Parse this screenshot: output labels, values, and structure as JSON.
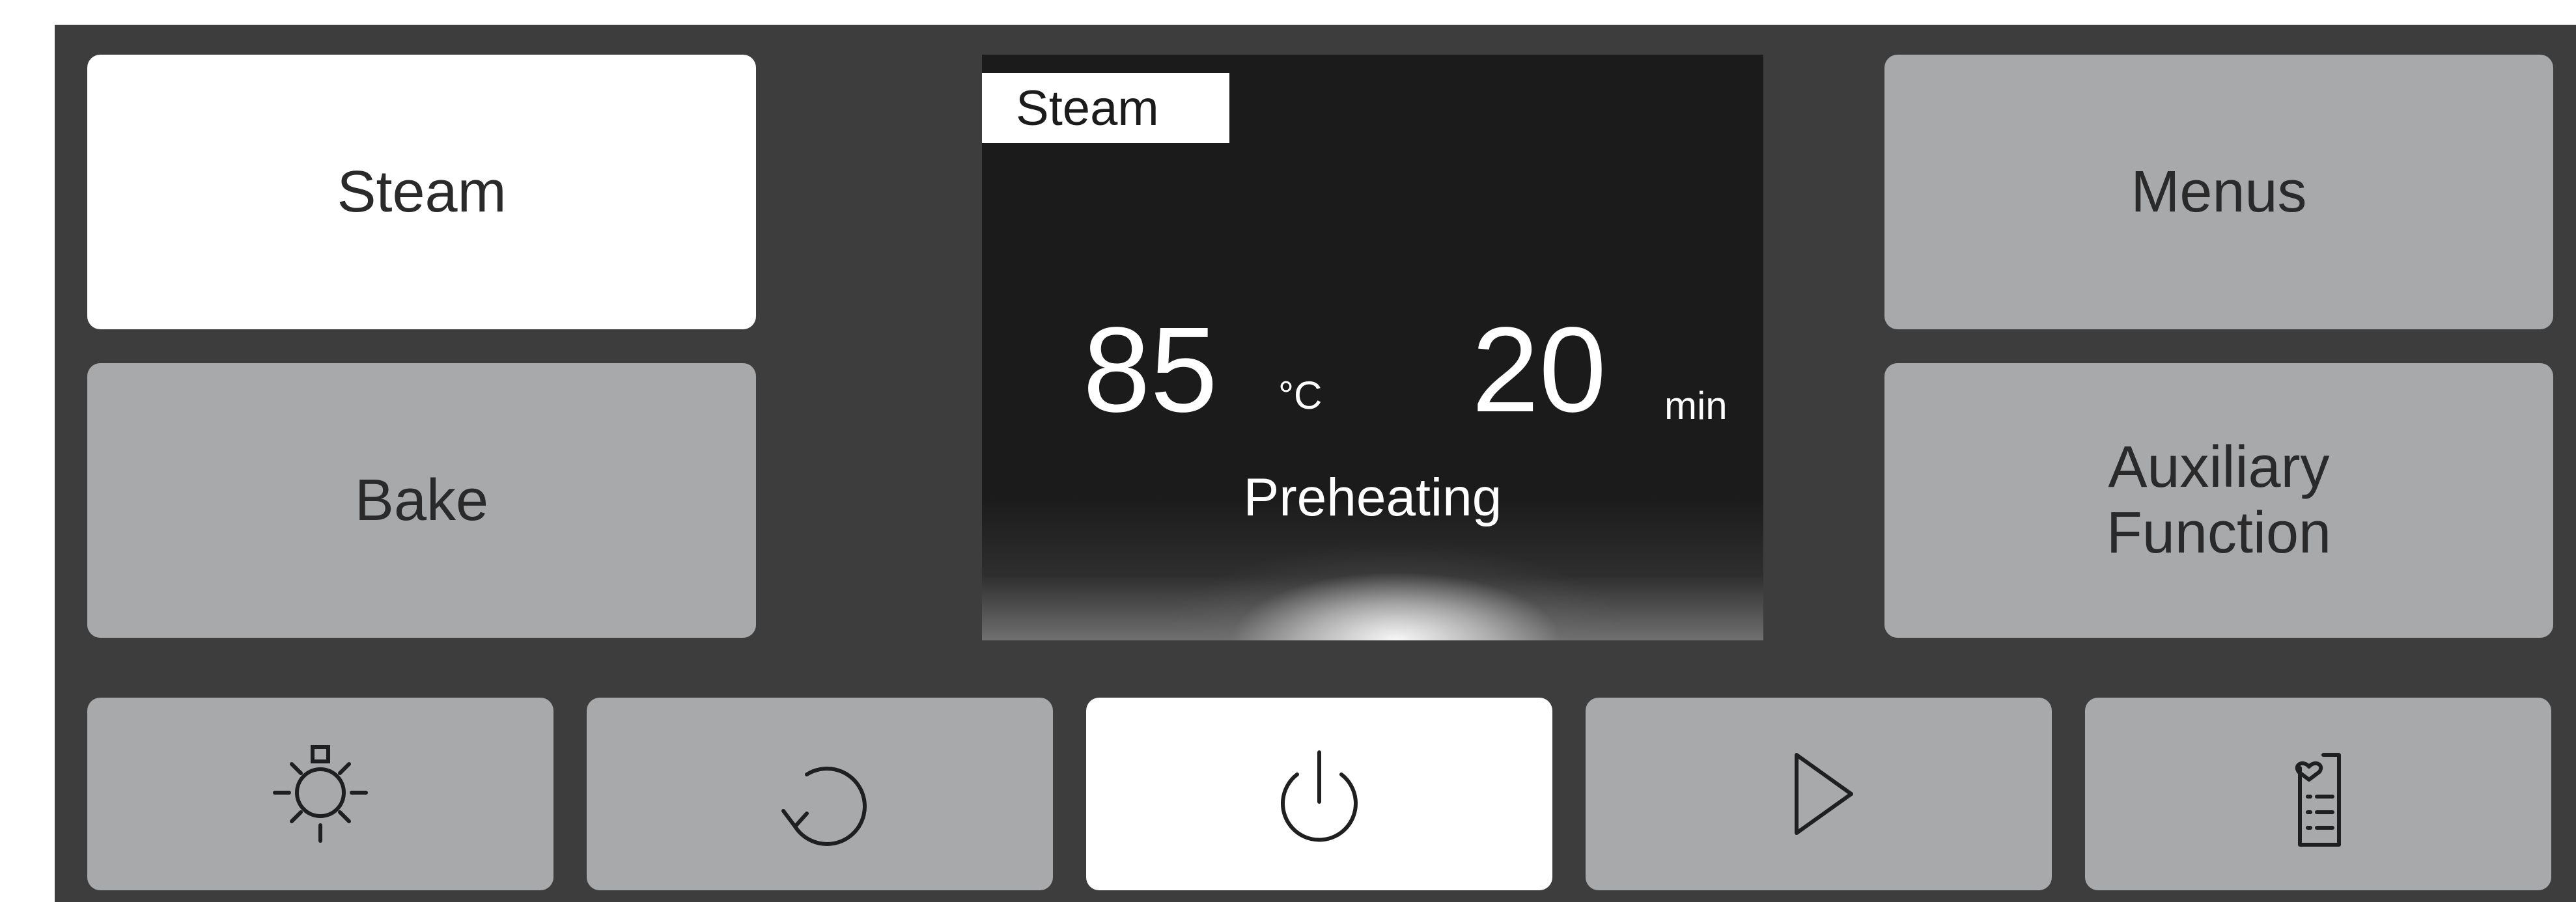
{
  "modes": {
    "steam_label": "Steam",
    "bake_label": "Bake",
    "menus_label": "Menus",
    "auxiliary_label_line1": "Auxiliary",
    "auxiliary_label_line2": "Function"
  },
  "display": {
    "mode_tag": "Steam",
    "temperature_value": "85",
    "temperature_unit": "°C",
    "time_value": "20",
    "time_unit": "min",
    "status": "Preheating"
  },
  "bottom_bar": {
    "icons": [
      "light-bulb-icon",
      "refresh-icon",
      "power-icon",
      "play-icon",
      "favorites-list-icon"
    ],
    "active": "power-icon"
  },
  "colors": {
    "panel": "#3d3d3d",
    "button": "#a8a9ab",
    "button_active": "#ffffff",
    "screen": "#1b1b1b",
    "text": "#2a2a2a"
  }
}
